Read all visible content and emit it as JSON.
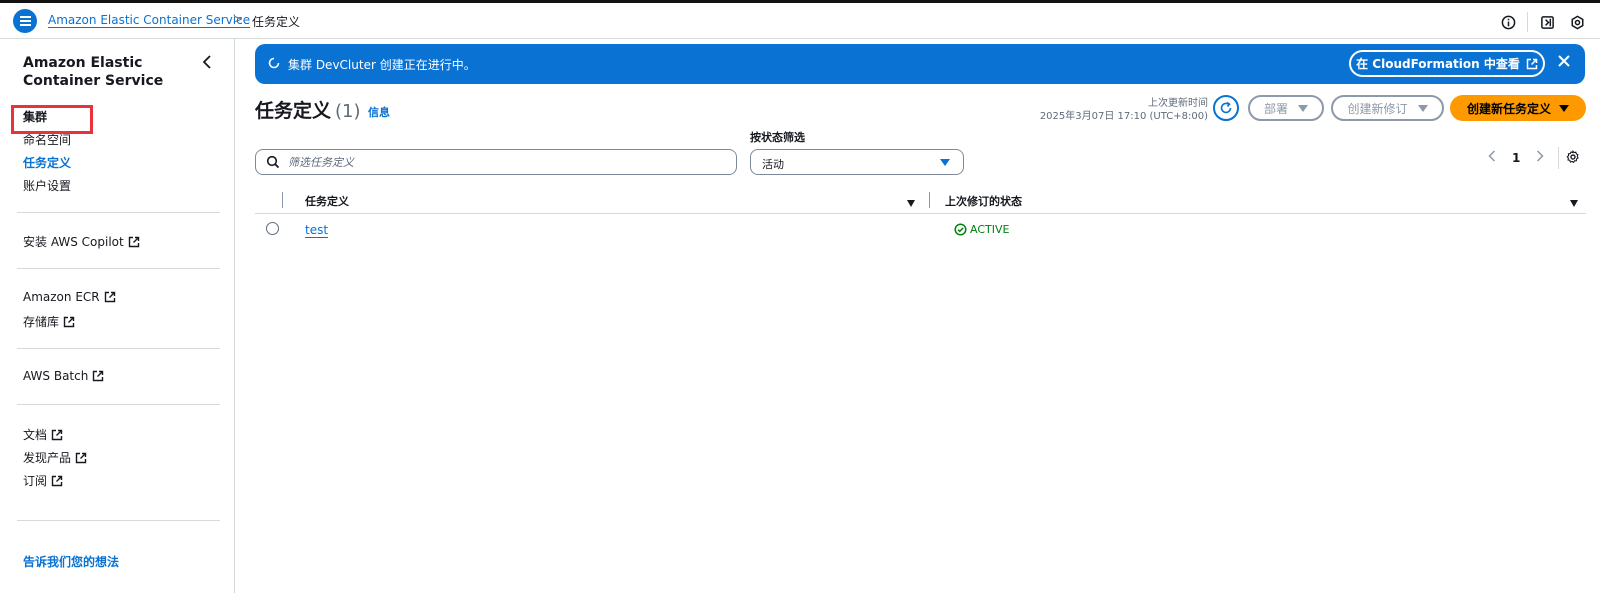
{
  "topbar": {
    "breadcrumb_service": "Amazon Elastic Container Service",
    "breadcrumb_separator": ">",
    "breadcrumb_current": "任务定义",
    "icons": [
      "menu-icon",
      "info-icon",
      "notifications-icon",
      "settings-icon"
    ]
  },
  "sidebar": {
    "title": "Amazon Elastic Container Service",
    "items": [
      {
        "label": "集群"
      },
      {
        "label": "命名空间"
      },
      {
        "label": "任务定义"
      },
      {
        "label": "账户设置"
      },
      {
        "label": "安装 AWS Copilot"
      },
      {
        "label": "Amazon ECR"
      },
      {
        "label": "存储库"
      },
      {
        "label": "AWS Batch"
      },
      {
        "label": "文档"
      },
      {
        "label": "发现产品"
      },
      {
        "label": "订阅"
      }
    ],
    "feedback": "告诉我们您的想法"
  },
  "flash": {
    "message": "集群 DevCluter 创建正在进行中。",
    "button_label": "在 CloudFormation 中查看"
  },
  "header": {
    "title": "任务定义",
    "count": "(1)",
    "info": "信息",
    "updated_label": "上次更新时间",
    "updated_time": "2025年3月07日 17:10 (UTC+8:00)",
    "deploy_label": "部署",
    "create_revision_label": "创建新修订",
    "create_label": "创建新任务定义"
  },
  "filters": {
    "search_placeholder": "筛选任务定义",
    "status_label": "按状态筛选",
    "status_value": "活动"
  },
  "pagination": {
    "current_page": "1"
  },
  "table": {
    "columns": [
      "任务定义",
      "上次修订的状态"
    ],
    "rows": [
      {
        "name": "test",
        "status": "ACTIVE"
      }
    ]
  },
  "colors": {
    "accent": "#0972d3",
    "primary_button": "#ff9900",
    "success": "#037f0c",
    "highlight": "#e8323c"
  }
}
